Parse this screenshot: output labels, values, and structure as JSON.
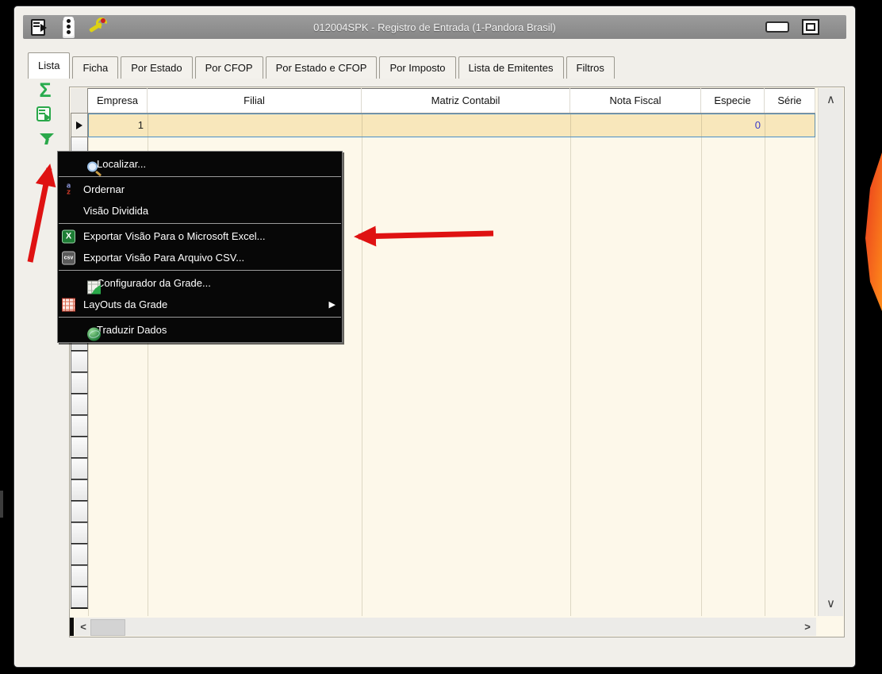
{
  "titlebar": {
    "title": "012004SPK - Registro de Entrada (1-Pandora Brasil)"
  },
  "tabs": [
    {
      "label": "Lista",
      "active": true
    },
    {
      "label": "Ficha",
      "active": false
    },
    {
      "label": "Por Estado",
      "active": false
    },
    {
      "label": "Por CFOP",
      "active": false
    },
    {
      "label": "Por Estado e CFOP",
      "active": false
    },
    {
      "label": "Por Imposto",
      "active": false
    },
    {
      "label": "Lista de Emitentes",
      "active": false
    },
    {
      "label": "Filtros",
      "active": false
    }
  ],
  "side_toolbar": {
    "sigma_glyph": "Σ",
    "icons": [
      "sigma-icon",
      "export-view-icon",
      "filter-icon"
    ]
  },
  "grid": {
    "columns": [
      {
        "label": "Empresa"
      },
      {
        "label": "Filial"
      },
      {
        "label": "Matriz Contabil"
      },
      {
        "label": "Nota Fiscal"
      },
      {
        "label": "Especie"
      },
      {
        "label": "Série"
      }
    ],
    "rows": [
      {
        "empresa": "1",
        "filial": "",
        "matriz_contabil": "",
        "nota_fiscal": "",
        "especie": "0",
        "serie": "",
        "selected": true
      }
    ]
  },
  "context_menu": {
    "items": [
      {
        "label": "Localizar...",
        "icon": "magnifier-icon"
      },
      {
        "label": "Ordernar",
        "icon": "sort-az-icon"
      },
      {
        "label": "Visão Dividida",
        "icon": "none"
      },
      {
        "label": "Exportar Visão Para o Microsoft Excel...",
        "icon": "excel-icon"
      },
      {
        "label": "Exportar Visão Para Arquivo CSV...",
        "icon": "csv-icon"
      },
      {
        "label": "Configurador da Grade...",
        "icon": "grid-config-icon"
      },
      {
        "label": "LayOuts da Grade",
        "icon": "table-layouts-icon",
        "has_submenu": true
      },
      {
        "label": "Traduzir Dados",
        "icon": "globe-icon"
      }
    ]
  },
  "icons": {
    "excel_x": "X",
    "csv_text": "csv",
    "sort_top": "a",
    "sort_bottom": "z",
    "submenu_arrow": "▶"
  },
  "scrollbars": {
    "up": "∧",
    "down": "∨",
    "left": "<",
    "right": ">"
  },
  "annotations": {
    "arrows": [
      {
        "points_at": "filter-icon"
      },
      {
        "points_at": "menu-item-exportar-excel"
      }
    ]
  },
  "colors": {
    "titlebar": "#8f8f8f",
    "window_bg": "#f1efea",
    "grid_bg": "#fdf8ea",
    "selection_fill": "#f8e7bb",
    "selection_border": "#4a90c8",
    "menu_bg": "#000000",
    "menu_text": "#ffffff",
    "arrow_red": "#df1212",
    "toolbar_green": "#2aa84a",
    "value_blue": "#3a3ac8",
    "artifact_orange": "#ff7a1a"
  }
}
